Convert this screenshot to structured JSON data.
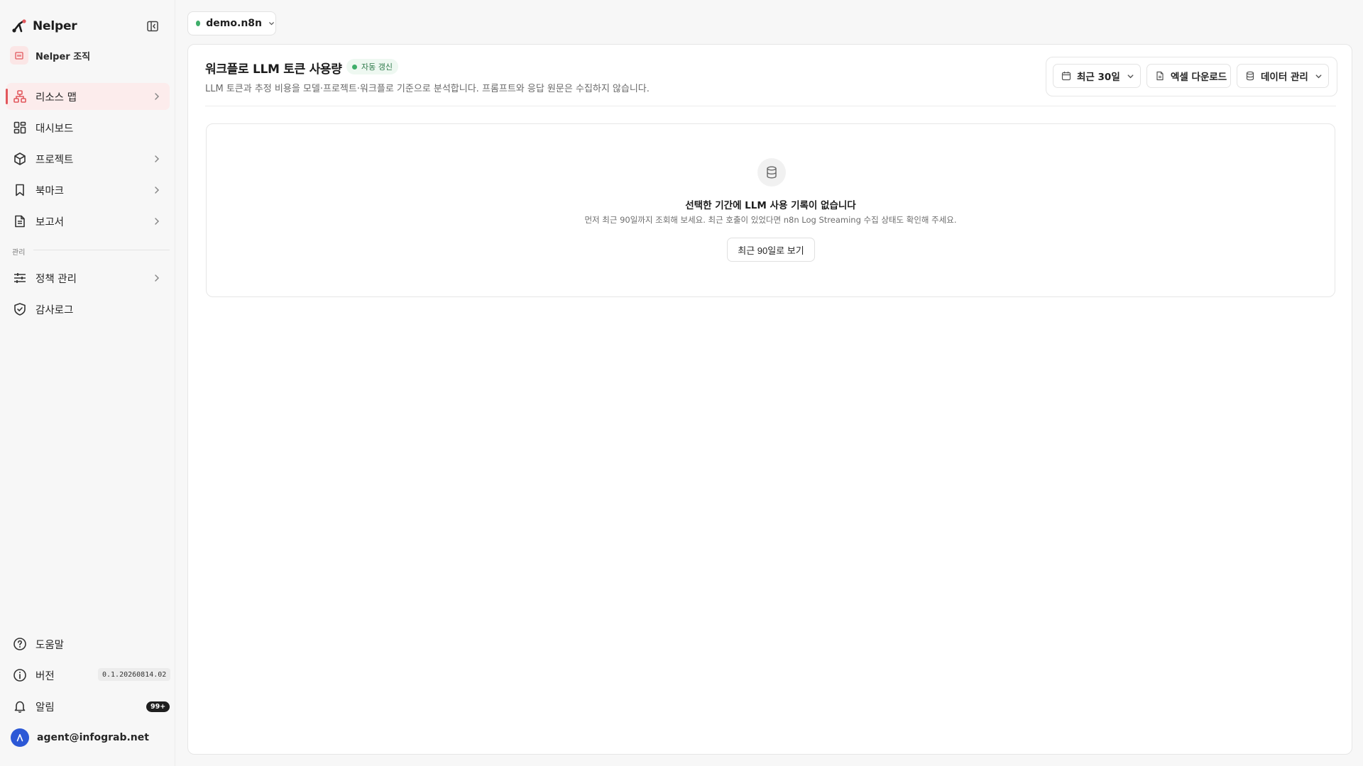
{
  "sidebar": {
    "brand": "Nelper",
    "organization": "Nelper 조직",
    "nav": [
      {
        "label": "리소스 맵",
        "active": true,
        "has_children": true
      },
      {
        "label": "대시보드",
        "active": false,
        "has_children": false
      },
      {
        "label": "프로젝트",
        "active": false,
        "has_children": true
      },
      {
        "label": "북마크",
        "active": false,
        "has_children": true
      },
      {
        "label": "보고서",
        "active": false,
        "has_children": true
      }
    ],
    "section_admin": "관리",
    "admin_nav": [
      {
        "label": "정책 관리",
        "has_children": true
      },
      {
        "label": "감사로그",
        "has_children": false
      }
    ],
    "footer": {
      "help": "도움말",
      "version_label": "버전",
      "version_value": "0.1.20260814.02",
      "notifications": "알림",
      "notifications_count": "99+",
      "user_initial": "A",
      "user_email": "agent@infograb.net"
    }
  },
  "workspace": {
    "name": "demo.n8n",
    "status_color": "#3fae6a"
  },
  "header": {
    "title": "워크플로 LLM 토큰 사용량",
    "badge": "자동 갱신",
    "subtitle": "LLM 토큰과 추정 비용을 모델·프로젝트·워크플로 기준으로 분석합니다. 프롬프트와 응답 원문은 수집하지 않습니다."
  },
  "toolbar": {
    "range_label": "최근 30일",
    "export_label": "엑셀 다운로드",
    "data_label": "데이터 관리"
  },
  "empty_state": {
    "title": "선택한 기간에 LLM 사용 기록이 없습니다",
    "description": "먼저 최근 90일까지 조회해 보세요. 최근 호출이 있었다면 n8n Log Streaming 수집 상태도 확인해 주세요.",
    "action_label": "최근 90일로 보기"
  },
  "colors": {
    "accent": "#e2575c",
    "active_bg": "#fcecec",
    "success": "#3fae6a",
    "avatar": "#2c58d6"
  }
}
